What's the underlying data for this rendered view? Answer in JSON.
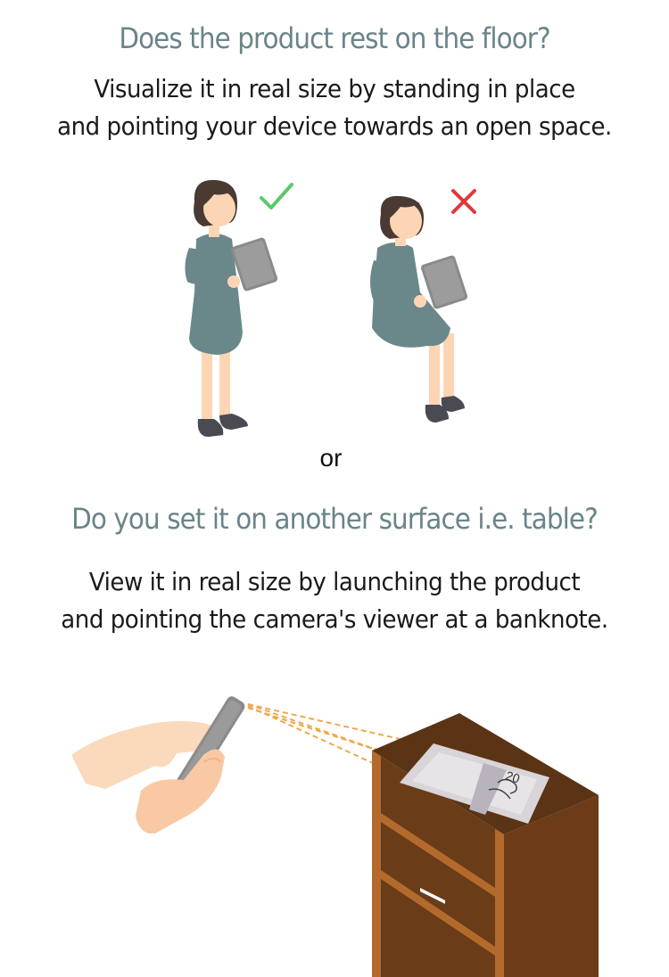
{
  "section1": {
    "heading": "Does the product rest on the floor?",
    "instruction_line1": "Visualize it in real size by standing in place",
    "instruction_line2": "and pointing your device towards an open space."
  },
  "figures": {
    "correct_icon": "checkmark-icon",
    "wrong_icon": "cross-icon",
    "correct_color": "#5cc86a",
    "wrong_color": "#e0393b"
  },
  "separator": "or",
  "section2": {
    "heading": "Do you set it on another surface i.e. table?",
    "instruction_line1": "View it in real size by launching the product",
    "instruction_line2": "and pointing the camera's viewer at a banknote."
  },
  "banknote": {
    "value": "20"
  },
  "colors": {
    "heading": "#6a8488",
    "dress": "#6a8889",
    "hair": "#4a3a32",
    "skin": "#fdd5b4",
    "tablet": "#8a8a8a",
    "shoe": "#4a4a52",
    "cabinet_top": "#5a3415",
    "cabinet_side": "#6a3c18",
    "cabinet_frame": "#b36a2c",
    "ray": "#f0a84a"
  }
}
